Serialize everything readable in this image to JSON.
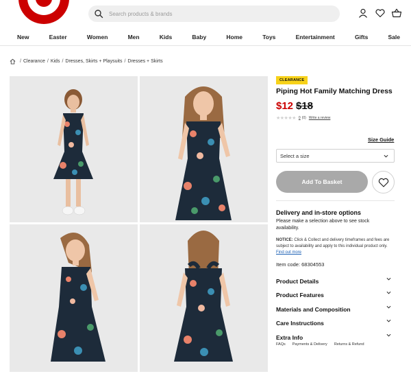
{
  "header": {
    "brand_color": "#cc0000",
    "search_placeholder": "Search products & brands",
    "icons": [
      "search-icon",
      "account-icon",
      "wishlist-heart-icon",
      "basket-icon"
    ]
  },
  "nav": [
    "New",
    "Easter",
    "Women",
    "Men",
    "Kids",
    "Baby",
    "Home",
    "Toys",
    "Entertainment",
    "Gifts",
    "Sale"
  ],
  "breadcrumb": [
    "Clearance",
    "Kids",
    "Dresses, Skirts + Playsuits",
    "Dresses + Skirts"
  ],
  "product": {
    "badge": "CLEARANCE",
    "title": "Piping Hot Family Matching Dress",
    "price_now": "$12",
    "price_was": "$18",
    "rating_count": "0",
    "rating_total": "(0)",
    "write_review": "Write a review",
    "size_guide": "Size Guide",
    "size_placeholder": "Select a size",
    "add_to_basket": "Add To Basket",
    "delivery_title": "Delivery and in-store options",
    "delivery_text": "Please make a selection above to see stock availability.",
    "notice_label": "NOTICE:",
    "notice_text": " Click & Collect and delivery timeframes and fees are subject to availability and apply to this individual product only. ",
    "notice_link": "Find out more",
    "item_code": "Item code: 68304553",
    "accordions": [
      "Product Details",
      "Product Features",
      "Materials and Composition",
      "Care Instructions",
      "Extra Info"
    ],
    "footer_links": [
      "FAQs",
      "Payments & Delivery",
      "Returns & Refund"
    ]
  },
  "colors": {
    "clearance_badge": "#f7d21a",
    "sale_price": "#cc0000",
    "basket_button_disabled": "#a9a9a9",
    "link": "#1a5fb4"
  }
}
